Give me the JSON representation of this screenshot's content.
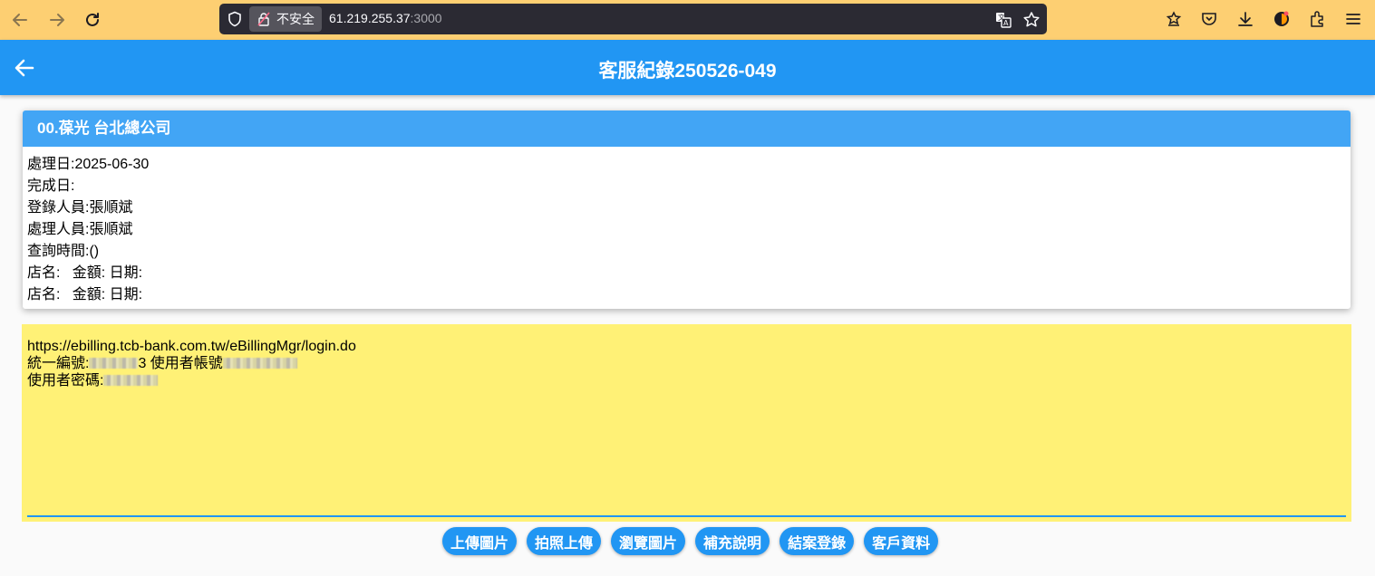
{
  "browser": {
    "security_label": "不安全",
    "url_host": "61.219.255.37",
    "url_port": ":3000",
    "icons": [
      "back-icon",
      "forward-icon",
      "reload-icon",
      "shield-icon",
      "insecure-lock-icon",
      "translate-icon",
      "bookmark-star-icon",
      "firefox-view-icon",
      "pocket-icon",
      "download-icon",
      "account-icon",
      "extensions-icon",
      "menu-icon"
    ]
  },
  "header": {
    "title": "客服紀錄250526-049",
    "color": "#2196f3"
  },
  "card": {
    "title": "00.葆光 台北總公司",
    "lines": [
      "處理日:2025-06-30",
      "完成日:",
      "登錄人員:張順斌",
      "處理人員:張順斌",
      "查詢時間:()",
      "店名:   金額: 日期:",
      "店名:   金額: 日期:"
    ]
  },
  "notes": {
    "url": "https://ebilling.tcb-bank.com.tw/eBillingMgr/login.do",
    "tax_id_label": "統一編號:",
    "tax_id_suffix": "3 使用者帳號",
    "password_label": "使用者密碼:",
    "background": "#fff176"
  },
  "actions": {
    "upload_image": "上傳圖片",
    "photo_upload": "拍照上傳",
    "browse_images": "瀏覽圖片",
    "supplement": "補充說明",
    "close_case": "結案登錄",
    "customer_data": "客戶資料"
  }
}
